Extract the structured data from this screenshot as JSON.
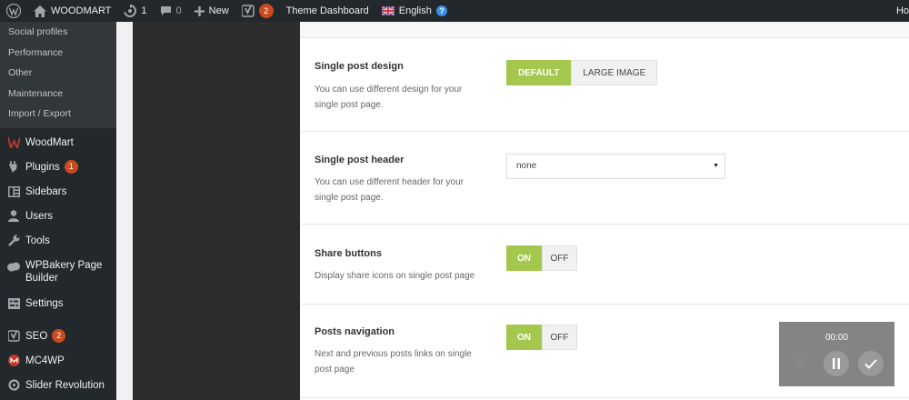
{
  "admin_bar": {
    "site_name": "WOODMART",
    "updates_count": "1",
    "comments_count": "0",
    "new_label": "New",
    "yoast_count": "2",
    "theme_dashboard": "Theme Dashboard",
    "language": "English",
    "right_text": "Ho"
  },
  "sidebar": {
    "submenu": [
      "Social profiles",
      "Performance",
      "Other",
      "Maintenance",
      "Import / Export"
    ],
    "woodmart": "WoodMart",
    "plugins": "Plugins",
    "plugins_badge": "1",
    "sidebars": "Sidebars",
    "users": "Users",
    "tools": "Tools",
    "wpbakery_line1": "WPBakery Page",
    "wpbakery_line2": "Builder",
    "settings": "Settings",
    "seo": "SEO",
    "seo_badge": "2",
    "mc4wp": "MC4WP",
    "slider_revolution": "Slider Revolution"
  },
  "settings": {
    "single_post_design": {
      "title": "Single post design",
      "desc_line1": "You can use different design for your",
      "desc_line2": "single post page.",
      "option_default": "DEFAULT",
      "option_large": "LARGE IMAGE",
      "selected": "DEFAULT"
    },
    "single_post_header": {
      "title": "Single post header",
      "desc_line1": "You can use different header for your",
      "desc_line2": "single post page.",
      "value": "none"
    },
    "share_buttons": {
      "title": "Share buttons",
      "desc": "Display share icons on single post page",
      "on": "ON",
      "off": "OFF",
      "selected": "ON"
    },
    "posts_navigation": {
      "title": "Posts navigation",
      "desc_line1": "Next and previous posts links on single",
      "desc_line2": "post page",
      "on": "ON",
      "off": "OFF",
      "selected": "ON"
    }
  },
  "recorder": {
    "time": "00:00"
  },
  "colors": {
    "accent_green": "#a4c84e",
    "admin_dark": "#23282d",
    "badge_orange": "#ca4a1f"
  }
}
